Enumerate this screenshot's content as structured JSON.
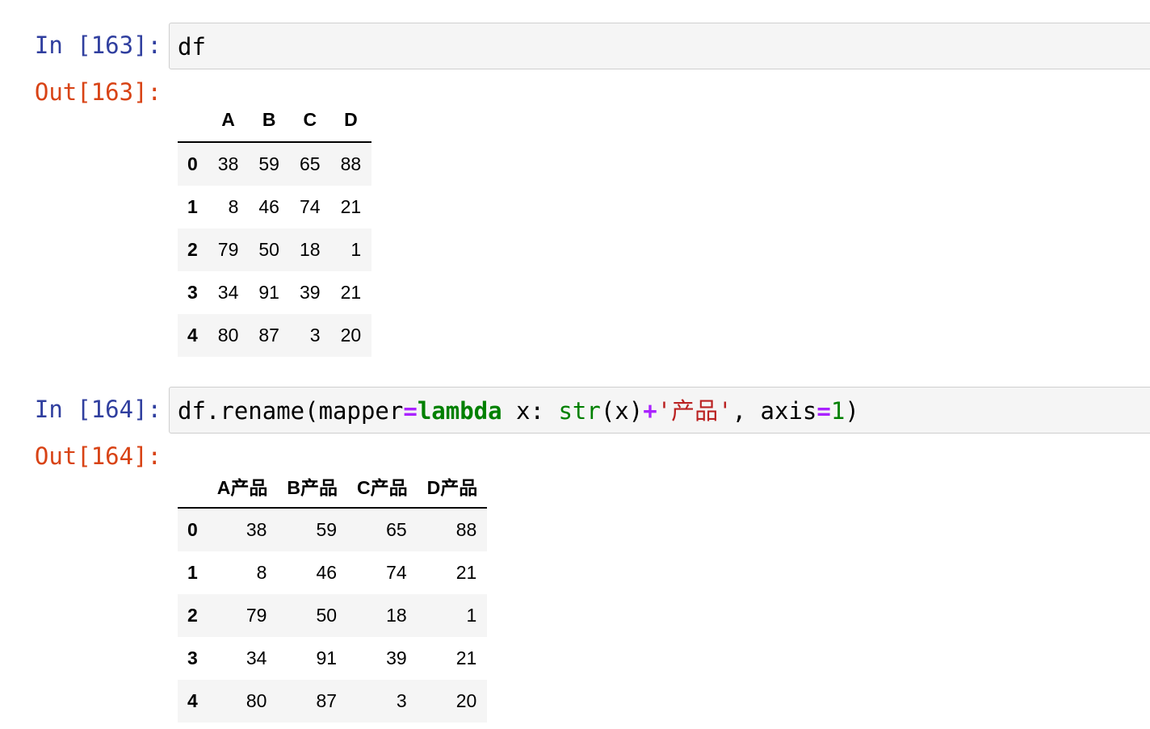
{
  "cells": [
    {
      "in_prompt": "In [163]:",
      "code_tokens": [
        {
          "cls": "",
          "text": "df"
        }
      ],
      "out_prompt": "Out[163]:",
      "table": {
        "columns": [
          "A",
          "B",
          "C",
          "D"
        ],
        "rows": [
          {
            "index": "0",
            "values": [
              "38",
              "59",
              "65",
              "88"
            ]
          },
          {
            "index": "1",
            "values": [
              "8",
              "46",
              "74",
              "21"
            ]
          },
          {
            "index": "2",
            "values": [
              "79",
              "50",
              "18",
              "1"
            ]
          },
          {
            "index": "3",
            "values": [
              "34",
              "91",
              "39",
              "21"
            ]
          },
          {
            "index": "4",
            "values": [
              "80",
              "87",
              "3",
              "20"
            ]
          }
        ]
      }
    },
    {
      "in_prompt": "In [164]:",
      "code_tokens": [
        {
          "cls": "",
          "text": "df.rename(mapper"
        },
        {
          "cls": "tok-op",
          "text": "="
        },
        {
          "cls": "tok-kw",
          "text": "lambda"
        },
        {
          "cls": "",
          "text": " x: "
        },
        {
          "cls": "tok-builtin",
          "text": "str"
        },
        {
          "cls": "",
          "text": "(x)"
        },
        {
          "cls": "tok-op",
          "text": "+"
        },
        {
          "cls": "tok-str",
          "text": "'产品'"
        },
        {
          "cls": "",
          "text": ", axis"
        },
        {
          "cls": "tok-op",
          "text": "="
        },
        {
          "cls": "tok-num",
          "text": "1"
        },
        {
          "cls": "",
          "text": ")"
        }
      ],
      "out_prompt": "Out[164]:",
      "table": {
        "columns": [
          "A产品",
          "B产品",
          "C产品",
          "D产品"
        ],
        "rows": [
          {
            "index": "0",
            "values": [
              "38",
              "59",
              "65",
              "88"
            ]
          },
          {
            "index": "1",
            "values": [
              "8",
              "46",
              "74",
              "21"
            ]
          },
          {
            "index": "2",
            "values": [
              "79",
              "50",
              "18",
              "1"
            ]
          },
          {
            "index": "3",
            "values": [
              "34",
              "91",
              "39",
              "21"
            ]
          },
          {
            "index": "4",
            "values": [
              "80",
              "87",
              "3",
              "20"
            ]
          }
        ]
      }
    }
  ],
  "colors": {
    "in_prompt": "#303f9f",
    "out_prompt": "#d84315",
    "input_bg": "#f5f5f5",
    "keyword": "#008000",
    "operator": "#aa22ff",
    "string": "#ba2121"
  }
}
